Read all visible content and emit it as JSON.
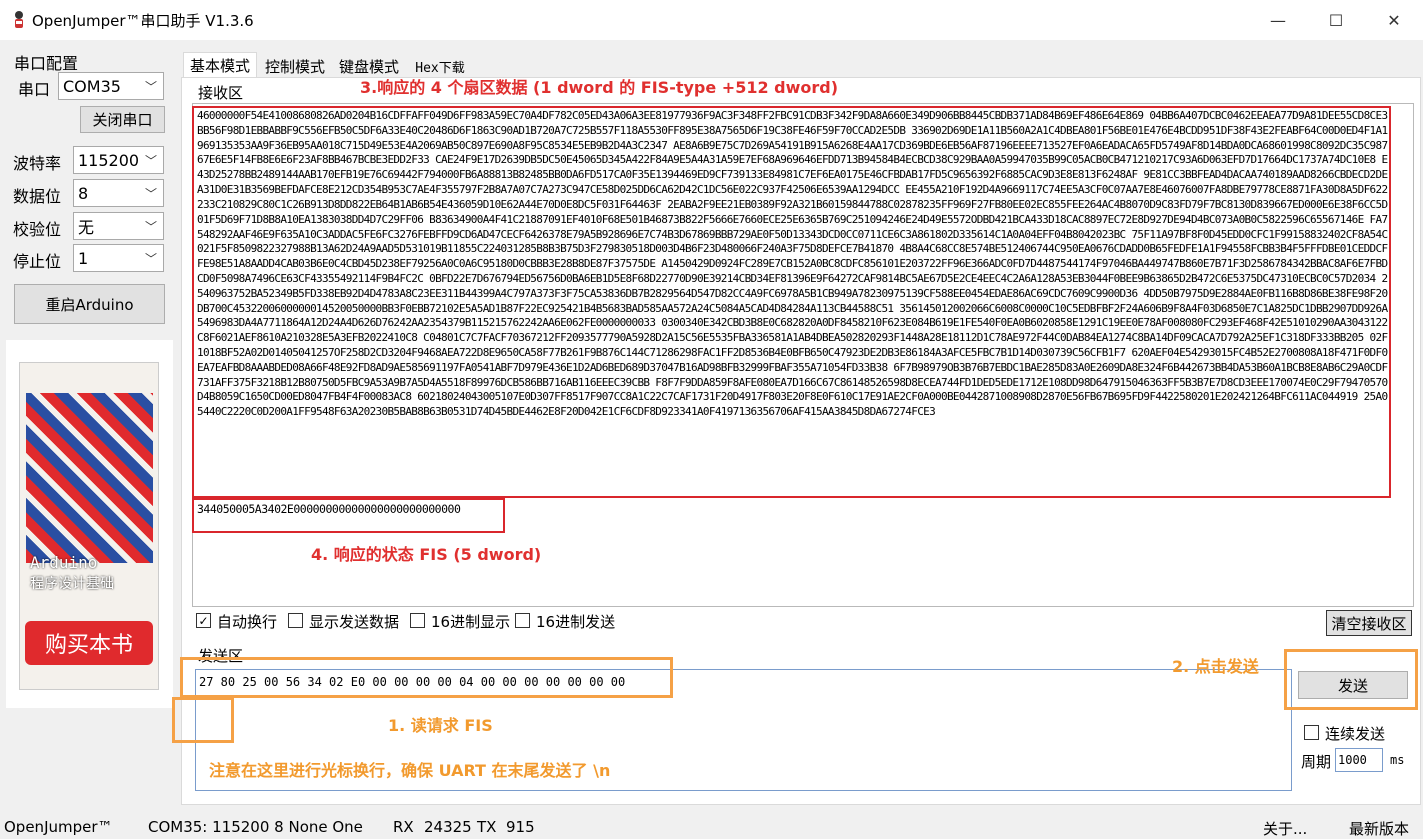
{
  "window": {
    "title": "OpenJumper™串口助手  V1.3.6",
    "minimize": "—",
    "maximize": "☐",
    "close": "✕"
  },
  "serial_config": {
    "group_label": "串口配置",
    "port_label": "串口",
    "port_value": "COM35",
    "close_port_button": "关闭串口",
    "baud_label": "波特率",
    "baud_value": "115200",
    "databits_label": "数据位",
    "databits_value": "8",
    "parity_label": "校验位",
    "parity_value": "无",
    "stopbits_label": "停止位",
    "stopbits_value": "1",
    "restart_button": "重启Arduino"
  },
  "book": {
    "title": "Arduino",
    "subtitle": "程序设计基础",
    "buy_button": "购买本书"
  },
  "tabs": [
    {
      "label": "基本模式"
    },
    {
      "label": "控制模式"
    },
    {
      "label": "键盘模式"
    },
    {
      "label": "Hex下载"
    }
  ],
  "receive": {
    "group_label": "接收区",
    "data": "46000000F54E41008680826AD0204B16CDFFAFF049D6FF983A59EC70A4DF782C05ED43A06A3EE81977936F9AC3F348FF2FBC91CDB3F342F9DA8A660E349D906BB8445CBDB371AD84B69EF486E64E869 04BB6A407DCBC0462EEAEA77D9A81DEE55CD8CE3BB56F98D1EBBABBF9C556EFB50C5DF6A33E40C20486D6F1863C90AD1B720A7C725B557F118A5530FF895E38A7565D6F19C38FE46F59F70CCAD2E5DB 336902D69DE1A11B560A2A1C4DBEA801F56BE01E476E4BCDD951DF38F43E2FEABF64C00D0ED4F1A1969135353AA9F36EB95AA018C715D49E53E4A2069AB50C897E690A8F95C8534E5EB9B2D4A3C2347 AE8A6B9E75C7D269A54191B915A6268E4AA17CD369BDE6EB56AF87196EEEE713527EF0A6EADACA65FD5749AF8D14BDA0DCA68601998C8092DC35C98767E6E5F14FB8E6E6F23AF8BB467BCBE3EDD2F33 CAE24F9E17D2639DB5DC50E45065D345A422F84A9E5A4A31A59E7EF68A969646EFDD713B94584B4ECBCD38C929BAA0A59947035B99C05ACB0CB471210217C93A6D063EFD7D17664DC1737A74DC10E8 E43D25278BB2489144AAB170EFB19E76C69442F794000FB6A88813B82485BB0DA6FD517CA0F35E1394469ED9CF739133E84981C7EF6EA0175E46CFBDAB17FD5C9656392F6885CAC9D3E8E813F6248AF 9E81CC3BBFEAD4DACAA740189AAD8266CBDECD2DEA31D0E31B3569BEFDAFCE8E212CD354B953C7AE4F355797F2B8A7A07C7A273C947CE58D025DD6CA62D42C1DC56E022C937F42506E6539AA1294DCC EE455A210F192D4A9669117C74EE5A3CF0C07AA7E8E46076007FA8DBE79778CE8871FA30D8A5DF622233C210829C80C1C26B913D8DD822EB64B1AB6B54E436059D10E62A44E70D0E8DC5F031F64463F 2EABA2F9EE21EB0389F92A321B60159844788C02878235FF969F27FB80EE02EC855FEE264AC4B8070D9C83FD79F7BC8130D839667ED000E6E38F6CC5D01F5D69F71D8B8A10EA1383038DD4D7C29FF06 B83634900A4F41C21887091EF4010F68E501B46873B822F5666E7660ECE25E6365B769C251094246E24D49E5572ODBD421BCA433D18CAC8897EC72E8D927DE94D4BC073A0B0C5822596C65567146E FA7548292AAF46E9F635A10C3ADDAC5FE6FC3276FEBFFD9CD6AD47CECF6426378E79A5B928696E7C74B3D67869BBB729AE0F50D13343DCD0CC0711CE6C3A861802D335614C1A0A04EFF04B8042023BC 75F11A97BF8F0D45EDD0CFC1F99158832402CF8A54C021F5F8509822327988B13A62D24A9AAD5D531019B11855C224031285B8B3B75D3F279830518D003D4B6F23D480066F240A3F75D8DEFCE7B41870 4B8A4C68CC8E574BE512406744C950EA0676CDADD0B65FEDFE1A1F94558FCBB3B4F5FFFDBE01CEDDCFFE98E51A8AADD4CAB03B6E0C4CBD45D238EF79256A0C0A6C95180D0CBBB3E28B8DE87F37575DE A1450429D0924FC289E7CB152A0BC8CDFC856101E203722FF96E366ADC0FD7D4487544174F97046BA449747B860E7B71F3D2586784342BBAC8AF6E7FBDCD0F5098A7496CE63CF43355492114F9B4FC2C 0BFD22E7D676794ED56756D0BA6EB1D5E8F68D22770D90E39214CBD34EF81396E9F64272CAF9814BC5AE67D5E2CE4EEC4C2A6A128A53EB3044F0BEE9B63865D2B472C6E5375DC47310ECBC0C57D2034 2540963752BA52349B5FD338EB92D4D4783A8C23EE311B44399A4C797A373F3F75CA53836DB7B2829564D547D82CC4A9FC6978A5B1CB949A78230975139CF588EE0454EDAE86AC69CDC7609C9900D36 4DD50B7975D9E2884AE0FB116B8D86BE38FE98F20DB700C4532200600000014520050000BB3F0EBB72102E5A5AD1B87F22EC925421B4B5683BAD585AA572A24C5084A5CAD4D84284A113CB44588C51 356145012002066C6008C0000C10C5EDBFBF2F24A606B9F8A4F03D6850E7C1A825DC1DBB2907DD926A5496983DA4A7711864A12D24A4D626D76242AA2354379B115215762242AA6E062FE0000000033 0300340E342CBD3B8E0C682820A0DF8458210F623E084B619E1FE540F0EA0B6020858E1291C19EE0E78AF008080FC293EF468F42E51010290AA3043122C8F6021AEF8610A210328E5A3EFB2022410C8 C04801C7C7FACF70367212FF2093577790A5928D2A15C56E5535FBA336581A1AB4DBEA502820293F1448A28E18112D1C78AE972F44C0DAB84EA1274C8BA14DF09CACA7D792A25EF1C318DF333BB205 02F1018BF52A02D01405041257OF258D2CD3204F9468AEA722D8E9650CA58F77B261F9B876C144C71286298FAC1FF2D8536B4E0BFB650C47923DE2DB3E86184A3AFCE5FBC7B1D14D030739C56CFB1F7 620AEF04E54293015FC4B52E2700808A18F471F0DF0EA7EAFBD8AAABDED08A66F48E92FD8AD9AE585691197FA0541ABF7D979E436E1D2AD6BED689D37047B16AD98BFB32999FBAF355A71054FD33B38 6F7B98979OB3B76B7EBDC1BAE285D83A0E2609DA8E324F6B442673BB4DA53B60A1BCB8E8AB6C29A0CDF731AFF375F3218B12B80750D5FBC9A53A9B7A5D4A5518F89976DCB586BB716AB116EEEC39CBB F8F7F9DDA859F8AFE080EA7D166C67C86148526598D8ECEA744FD1DED5EDE1712E108DD98D647915046363FF5B3B7E7D8CD3EEE170074E0C29F79470570D4B8059C1650CD00ED8047FB4F4F00083AC8 60218024043005107E0D307FF8517F907CC8A1C22C7CAF1731F20D4917F803E20F8E0F610C17E91AE2CF0A000BE0442871008908D2870E56FB67B695FD9F4422580201E202421264BFC611AC044919 25A05440C2220C0D200A1FF9548F63A20230B5BAB8B63B0531D74D45BDE4462E8F20D042E1CF6CDF8D923341A0F4197136356706AF415AA3845D8DA67274FCE3",
    "status_fis": "344050005A3402E00000000000000000000000000",
    "checkboxes": [
      {
        "label": "自动换行",
        "checked": true
      },
      {
        "label": "显示发送数据",
        "checked": false
      },
      {
        "label": "16进制显示",
        "checked": false
      },
      {
        "label": "16进制发送",
        "checked": false
      }
    ],
    "clear_button": "清空接收区"
  },
  "send": {
    "group_label": "发送区",
    "value": "27 80 25 00 56 34 02 E0 00 00 00 00 04 00 00 00 00 00 00 00",
    "send_button": "发送",
    "continuous_label": "连续发送",
    "period_label": "周期",
    "period_value": "1000",
    "period_unit": "ms"
  },
  "annotations": {
    "a1": "1. 读请求 FIS",
    "a2": "2. 点击发送",
    "a3": "3.响应的 4 个扇区数据  (1 dword 的 FIS-type +512 dword)",
    "a4": "4. 响应的状态 FIS (5 dword)",
    "note": "注意在这里进行光标换行，确保 UART 在末尾发送了 \\n"
  },
  "statusbar": {
    "brand": "OpenJumper™",
    "port_info": "COM35: 115200 8 None One",
    "rx_label": "RX",
    "rx_value": "24325",
    "tx_label": "TX",
    "tx_value": "915",
    "about": "关于...",
    "latest": "最新版本"
  },
  "colors": {
    "annotation_red": "#d9262c",
    "annotation_orange": "#f5a146",
    "book_red": "#e02a2d",
    "book_blue": "#2a4fa3"
  }
}
